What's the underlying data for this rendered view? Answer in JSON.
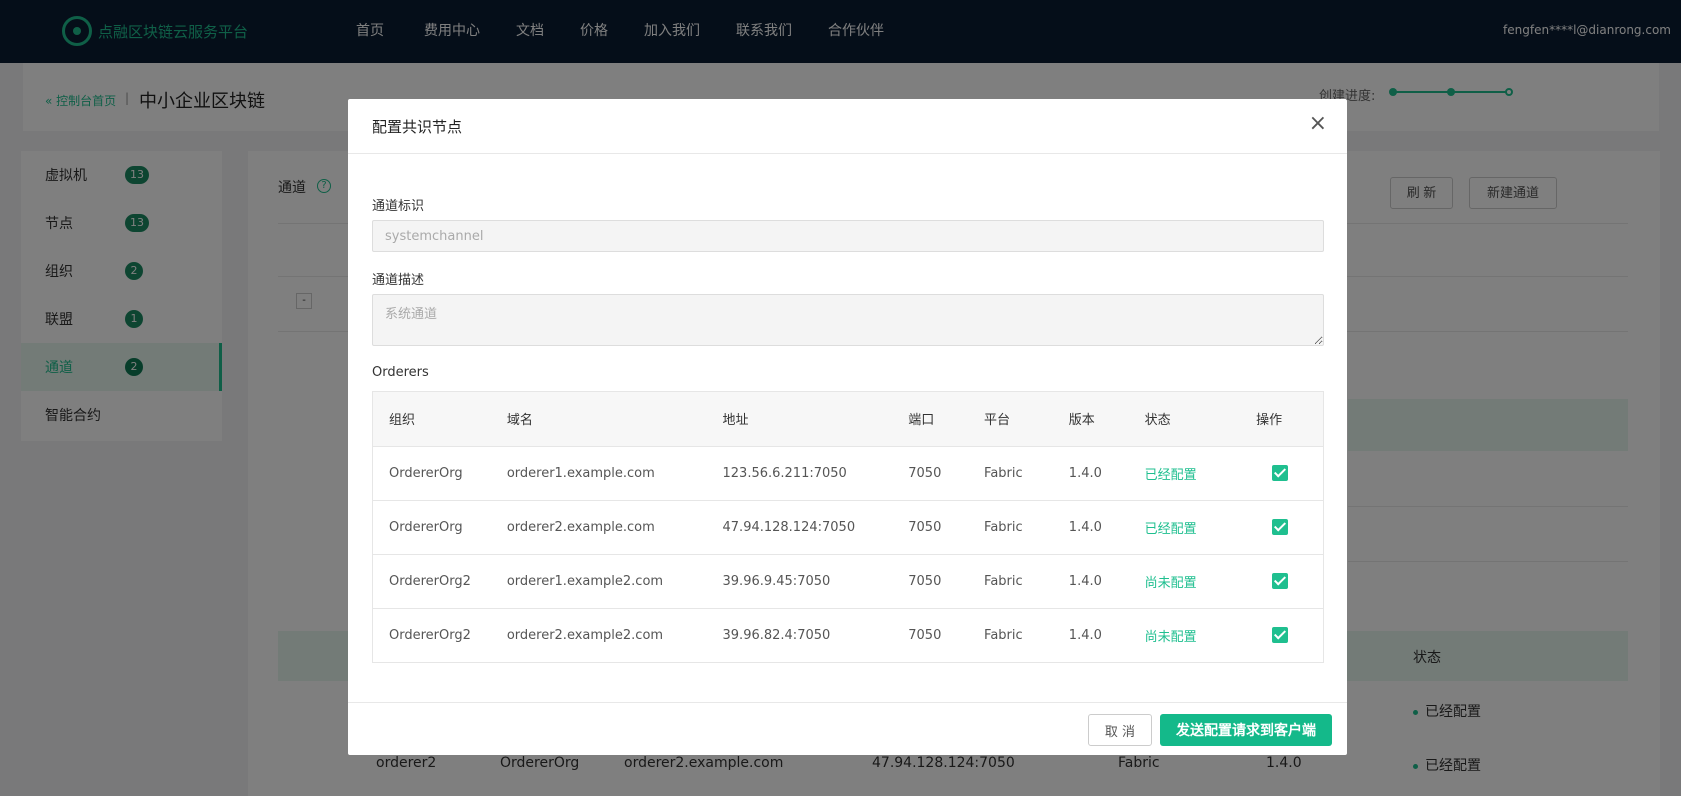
{
  "topbar": {
    "logo_text": "点融区块链云服务平台",
    "nav": [
      "首页",
      "费用中心",
      "文档",
      "价格",
      "加入我们",
      "联系我们",
      "合作伙伴"
    ],
    "user_email": "fengfen****l@dianrong.com"
  },
  "crumb": {
    "back_label": "« 控制台首页",
    "separator": "|",
    "title": "中小企业区块链",
    "progress_label": "创建进度:"
  },
  "sidebar": {
    "items": [
      {
        "label": "虚拟机",
        "badge": "13"
      },
      {
        "label": "节点",
        "badge": "13"
      },
      {
        "label": "组织",
        "badge": "2"
      },
      {
        "label": "联盟",
        "badge": "1"
      },
      {
        "label": "通道",
        "badge": "2"
      },
      {
        "label": "智能合约",
        "badge": ""
      }
    ]
  },
  "panel": {
    "title": "通道",
    "help_icon": "?",
    "refresh_label": "刷 新",
    "new_label": "新建通道",
    "collapse_icon": "-",
    "status_header": "状态",
    "status_values": [
      "已经配置",
      "已经配置"
    ],
    "row": [
      "orderer2",
      "OrdererOrg",
      "orderer2.example.com",
      "47.94.128.124:7050",
      "Fabric",
      "1.4.0"
    ]
  },
  "modal": {
    "title": "配置共识节点",
    "close_icon": "×",
    "channel_id_label": "通道标识",
    "channel_id_value": "systemchannel",
    "channel_desc_label": "通道描述",
    "channel_desc_value": "系统通道",
    "orderers_label": "Orderers",
    "columns": [
      "组织",
      "域名",
      "地址",
      "端口",
      "平台",
      "版本",
      "状态",
      "操作"
    ],
    "rows": [
      {
        "org": "OrdererOrg",
        "domain": "orderer1.example.com",
        "address": "123.56.6.211:7050",
        "port": "7050",
        "platform": "Fabric",
        "version": "1.4.0",
        "status": "已经配置",
        "checked": true
      },
      {
        "org": "OrdererOrg",
        "domain": "orderer2.example.com",
        "address": "47.94.128.124:7050",
        "port": "7050",
        "platform": "Fabric",
        "version": "1.4.0",
        "status": "已经配置",
        "checked": true
      },
      {
        "org": "OrdererOrg2",
        "domain": "orderer1.example2.com",
        "address": "39.96.9.45:7050",
        "port": "7050",
        "platform": "Fabric",
        "version": "1.4.0",
        "status": "尚未配置",
        "checked": true
      },
      {
        "org": "OrdererOrg2",
        "domain": "orderer2.example2.com",
        "address": "39.96.82.4:7050",
        "port": "7050",
        "platform": "Fabric",
        "version": "1.4.0",
        "status": "尚未配置",
        "checked": true
      }
    ],
    "cancel_label": "取 消",
    "submit_label": "发送配置请求到客户端"
  },
  "colors": {
    "accent": "#1fbf8f",
    "topbar_bg": "#0b1d33",
    "overlay": "rgba(0,0,0,0.5)"
  }
}
